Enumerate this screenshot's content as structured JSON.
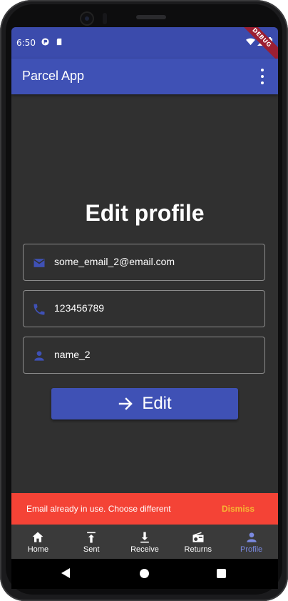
{
  "status_bar": {
    "time": "6:50"
  },
  "debug_banner": "DEBUG",
  "app_bar": {
    "title": "Parcel App"
  },
  "page": {
    "title": "Edit profile"
  },
  "fields": {
    "email": {
      "value": "some_email_2@email.com",
      "icon": "email-icon"
    },
    "phone": {
      "value": "123456789",
      "icon": "phone-icon"
    },
    "name": {
      "value": "name_2",
      "icon": "person-icon"
    }
  },
  "edit_button": {
    "label": "Edit",
    "icon": "arrow-right-icon"
  },
  "snackbar": {
    "message": "Email already in use. Choose different",
    "action": "Dismiss"
  },
  "bottom_nav": {
    "items": [
      {
        "label": "Home",
        "icon": "home-icon",
        "active": false
      },
      {
        "label": "Sent",
        "icon": "upload-icon",
        "active": false
      },
      {
        "label": "Receive",
        "icon": "download-icon",
        "active": false
      },
      {
        "label": "Returns",
        "icon": "radio-icon",
        "active": false
      },
      {
        "label": "Profile",
        "icon": "person-icon",
        "active": true
      }
    ]
  },
  "colors": {
    "primary": "#3f51b5",
    "status_bar": "#3b4bac",
    "background": "#303030",
    "snackbar": "#f44336",
    "snackbar_action": "#f7b733",
    "active_nav": "#7b8ae0"
  }
}
